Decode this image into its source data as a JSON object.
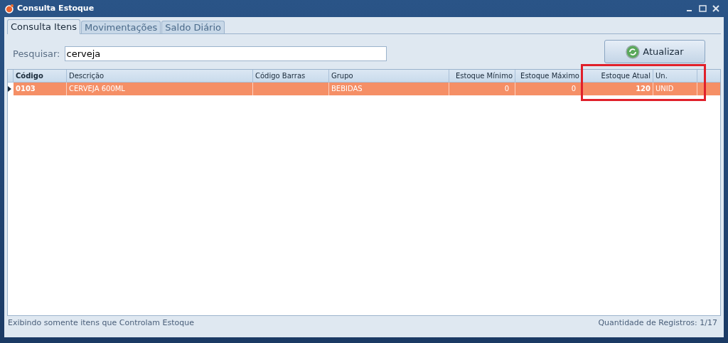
{
  "window": {
    "title": "Consulta Estoque"
  },
  "tabs": [
    {
      "label": "Consulta Itens",
      "selected": true
    },
    {
      "label": "Movimentações",
      "selected": false
    },
    {
      "label": "Saldo Diário",
      "selected": false
    }
  ],
  "search": {
    "label": "Pesquisar:",
    "value": "cerveja"
  },
  "refresh_button": {
    "label": "Atualizar"
  },
  "table": {
    "columns": [
      {
        "label": "Código",
        "kind": "key"
      },
      {
        "label": "Descrição",
        "kind": "text"
      },
      {
        "label": "Código Barras",
        "kind": "text"
      },
      {
        "label": "Grupo",
        "kind": "text"
      },
      {
        "label": "Estoque Mínimo",
        "kind": "number"
      },
      {
        "label": "Estoque Máximo",
        "kind": "number"
      },
      {
        "label": "Estoque Atual",
        "kind": "total"
      },
      {
        "label": "Un.",
        "kind": "text"
      }
    ],
    "rows": [
      {
        "selected": true,
        "cells": [
          "0103",
          "CERVEJA 600ML",
          "",
          "BEBIDAS",
          "0",
          "0",
          "120",
          "UNID"
        ]
      }
    ]
  },
  "status_bar": {
    "left": "Exibindo somente itens que Controlam Estoque",
    "right": "Quantidade de Registros: 1/17"
  }
}
